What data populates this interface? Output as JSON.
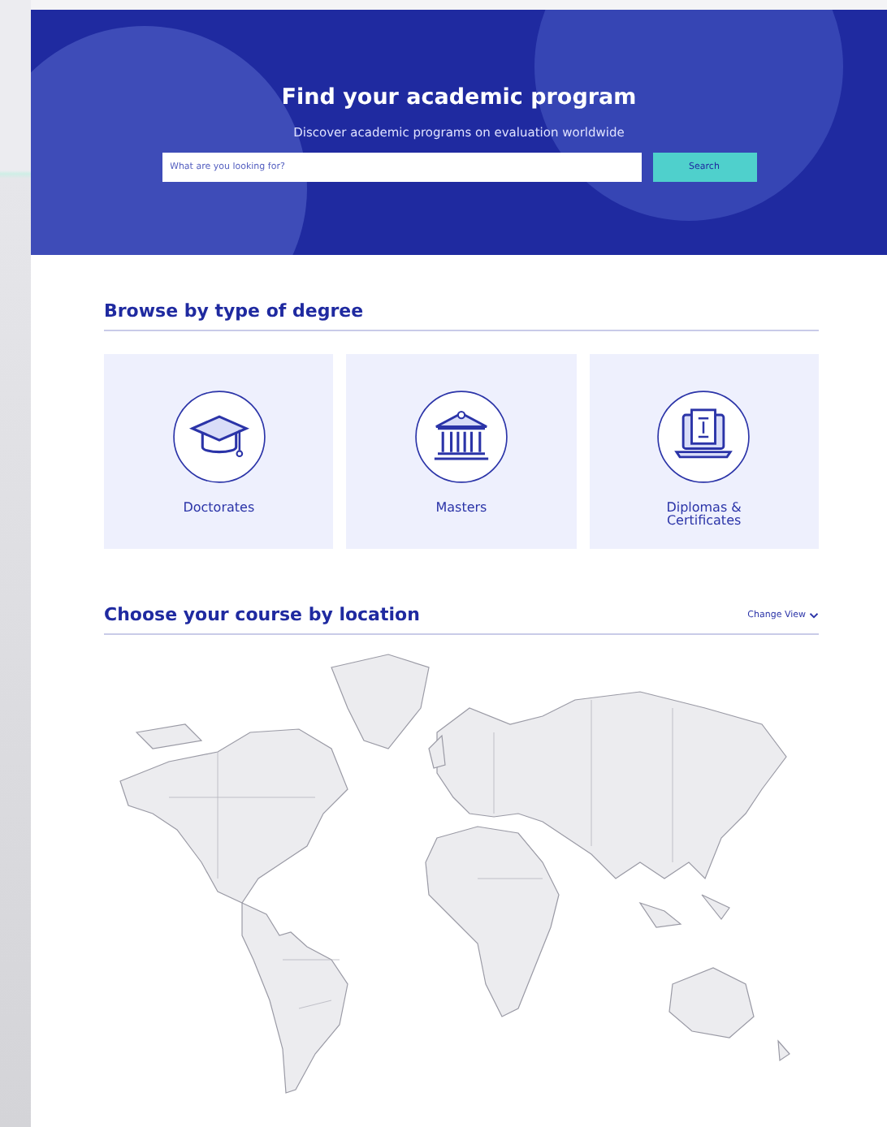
{
  "hero": {
    "title": "Find your academic program",
    "subtitle": "Discover academic programs on evaluation worldwide",
    "search": {
      "placeholder": "What are you looking for?",
      "button": "Search"
    }
  },
  "degree_section": {
    "title": "Browse by type of degree",
    "cards": [
      {
        "kind": "cap",
        "label": "Doctorates"
      },
      {
        "kind": "building",
        "label": "Masters"
      },
      {
        "kind": "laptop",
        "label": "Diplomas & Certificates"
      }
    ]
  },
  "location_section": {
    "title": "Choose your course by location",
    "change_view": "Change View"
  }
}
